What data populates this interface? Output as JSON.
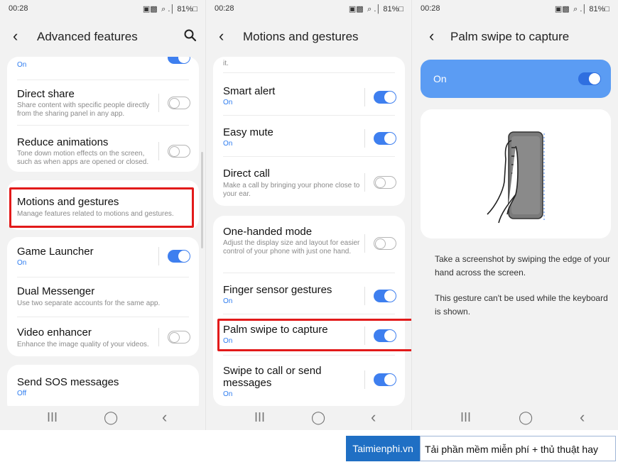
{
  "status": {
    "time": "00:28",
    "indicators": "▣▩ ⌕ .│ 81%□"
  },
  "screen1": {
    "title": "Advanced features",
    "partial_on": "On",
    "items": [
      {
        "title": "Direct share",
        "sub": "Share content with specific people directly from the sharing panel in any app."
      },
      {
        "title": "Reduce animations",
        "sub": "Tone down motion effects on the screen, such as when apps are opened or closed."
      },
      {
        "title": "Motions and gestures",
        "sub": "Manage features related to motions and gestures."
      },
      {
        "title": "Game Launcher",
        "state": "On"
      },
      {
        "title": "Dual Messenger",
        "sub": "Use two separate accounts for the same app."
      },
      {
        "title": "Video enhancer",
        "sub": "Enhance the image quality of your videos."
      },
      {
        "title": "Send SOS messages",
        "state": "Off"
      }
    ]
  },
  "screen2": {
    "title": "Motions and gestures",
    "partial_text": "it.",
    "items": [
      {
        "title": "Smart alert",
        "state": "On"
      },
      {
        "title": "Easy mute",
        "state": "On"
      },
      {
        "title": "Direct call",
        "sub": "Make a call by bringing your phone close to your ear."
      },
      {
        "title": "One-handed mode",
        "sub": "Adjust the display size and layout for easier control of your phone with just one hand."
      },
      {
        "title": "Finger sensor gestures",
        "state": "On"
      },
      {
        "title": "Palm swipe to capture",
        "state": "On"
      },
      {
        "title": "Swipe to call or send messages",
        "state": "On"
      }
    ]
  },
  "screen3": {
    "title": "Palm swipe to capture",
    "master_label": "On",
    "desc1": "Take a screenshot by swiping the edge of your hand across the screen.",
    "desc2": "This gesture can't be used while the keyboard is shown."
  },
  "nav": {
    "recent": "III",
    "home": "◯",
    "back": "‹"
  },
  "brand": {
    "name": "Taimienphi.vn",
    "tagline": "Tải phần mềm miễn phí + thủ thuật hay"
  },
  "colors": {
    "accent": "#3e7fef",
    "highlight": "#e21a1a",
    "brand_bg": "#1f6fc4"
  },
  "icons": [
    "back-icon",
    "search-icon",
    "toggle-switch",
    "recent-apps-icon",
    "home-icon",
    "nav-back-icon",
    "hand-phone-illustration"
  ]
}
